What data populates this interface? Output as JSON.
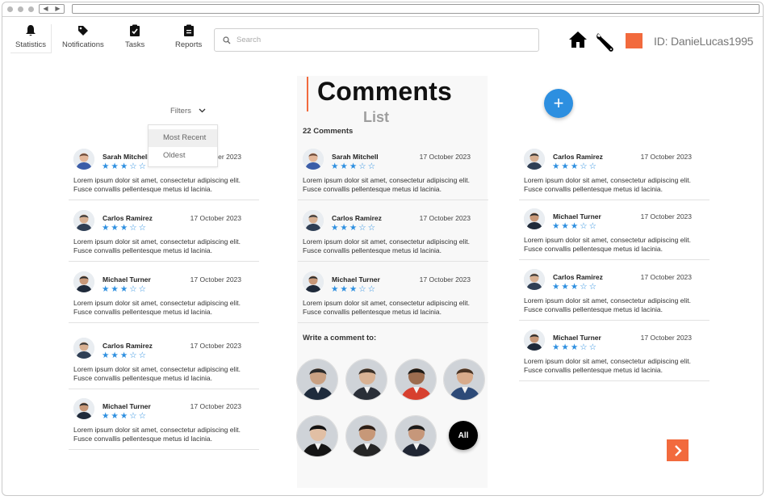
{
  "toolbar": {
    "items": [
      {
        "label": "Statistics",
        "icon": "bell-icon"
      },
      {
        "label": "Notifications",
        "icon": "tag-icon"
      },
      {
        "label": "Tasks",
        "icon": "clipboard-check-icon"
      },
      {
        "label": "Reports",
        "icon": "clipboard-list-icon"
      }
    ],
    "search_placeholder": "Search",
    "user_id": "ID: DanieLucas1995"
  },
  "filters": {
    "label": "Filters",
    "options": [
      "Most Recent",
      "Oldest"
    ]
  },
  "center": {
    "title": "Comments",
    "subtitle": "List",
    "count": "22 Comments",
    "write_label": "Write a comment to:",
    "all_label": "All"
  },
  "comment_text": "Lorem ipsum dolor sit amet, consectetur adipiscing elit. Fusce convallis pellentesque metus id lacinia.",
  "left_comments": [
    {
      "name": "Sarah Mitchell",
      "date": "17 October 2023",
      "stars": "★★★☆☆"
    },
    {
      "name": "Carlos Ramirez",
      "date": "17 October 2023",
      "stars": "★★★☆☆"
    },
    {
      "name": "Michael Turner",
      "date": "17 October 2023",
      "stars": "★★★☆☆"
    },
    {
      "name": "Carlos Ramirez",
      "date": "17 October 2023",
      "stars": "★★★☆☆"
    },
    {
      "name": "Michael Turner",
      "date": "17 October 2023",
      "stars": "★★★☆☆"
    }
  ],
  "center_comments": [
    {
      "name": "Sarah Mitchell",
      "date": "17 October 2023",
      "stars": "★★★☆☆"
    },
    {
      "name": "Carlos Ramirez",
      "date": "17 October 2023",
      "stars": "★★★☆☆"
    },
    {
      "name": "Michael Turner",
      "date": "17 October 2023",
      "stars": "★★★☆☆"
    }
  ],
  "right_comments": [
    {
      "name": "Carlos Ramirez",
      "date": "17 October 2023",
      "stars": "★★★☆☆"
    },
    {
      "name": "Michael Turner",
      "date": "17 October 2023",
      "stars": "★★★☆☆"
    },
    {
      "name": "Carlos Ramirez",
      "date": "17 October 2023",
      "stars": "★★★☆☆"
    },
    {
      "name": "Michael Turner",
      "date": "17 October 2023",
      "stars": "★★★☆☆"
    }
  ],
  "colors": {
    "accent": "#f26a3d",
    "blue": "#2d8fe0"
  }
}
